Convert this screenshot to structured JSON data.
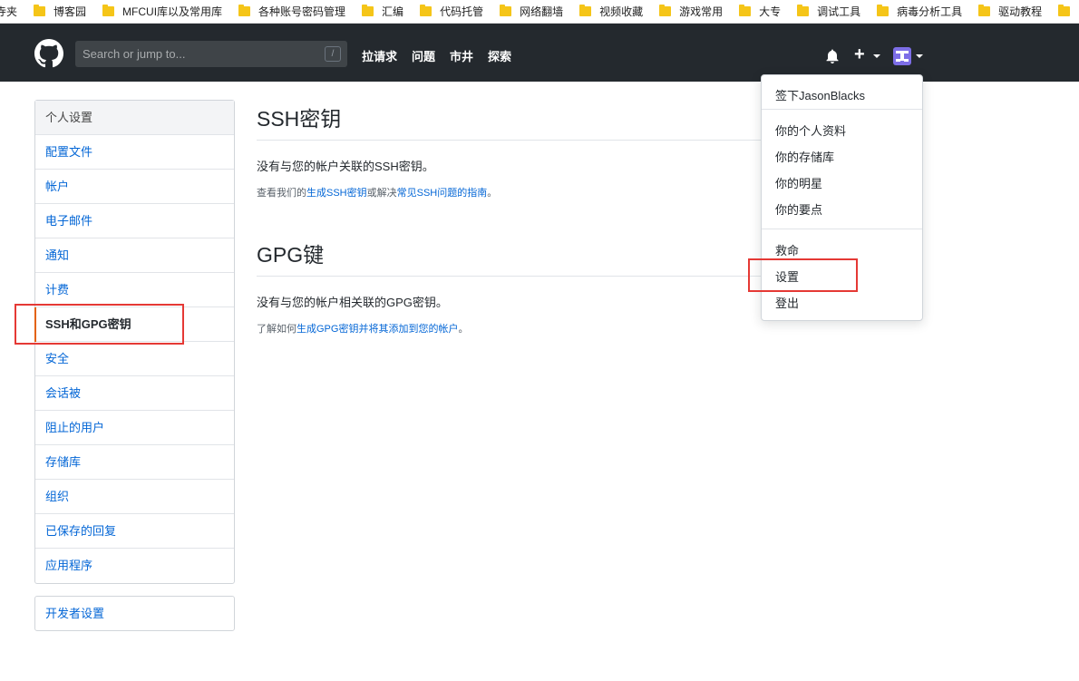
{
  "bookmarks": [
    "寺夹",
    "博客园",
    "MFCUI库以及常用库",
    "各种账号密码管理",
    "汇编",
    "代码托管",
    "网络翻墙",
    "视频收藏",
    "游戏常用",
    "大专",
    "调试工具",
    "病毒分析工具",
    "驱动教程"
  ],
  "header": {
    "search_placeholder": "Search or jump to...",
    "slash_key": "/",
    "nav": [
      "拉请求",
      "问题",
      "市井",
      "探索"
    ],
    "plus": "+"
  },
  "sidebar": {
    "title": "个人设置",
    "items": [
      "配置文件",
      "帐户",
      "电子邮件",
      "通知",
      "计费",
      "SSH和GPG密钥",
      "安全",
      "会话被",
      "阻止的用户",
      "存储库",
      "组织",
      "已保存的回复",
      "应用程序"
    ],
    "active_index": 5,
    "developer": "开发者设置"
  },
  "main": {
    "ssh": {
      "title": "SSH密钥",
      "empty": "没有与您的帐户关联的SSH密钥。",
      "note_prefix": "查看我们的",
      "note_link1": "生成SSH密钥",
      "note_mid": "或解决",
      "note_link2": "常见SSH问题的指南",
      "note_suffix": "。"
    },
    "gpg": {
      "title": "GPG键",
      "empty": "没有与您的帐户相关联的GPG密钥。",
      "note_prefix": "了解如何",
      "note_link": "生成GPG密钥并将其添加到您的帐户",
      "note_suffix": "。"
    }
  },
  "dropdown": {
    "signed_in": "签下JasonBlacks",
    "group1": [
      "你的个人资料",
      "你的存储库",
      "你的明星",
      "你的要点"
    ],
    "group2": [
      "救命",
      "设置",
      "登出"
    ]
  },
  "colors": {
    "header_bg": "#24292e",
    "link": "#0366d6",
    "active_bar": "#e36209",
    "highlight": "#e53935"
  }
}
